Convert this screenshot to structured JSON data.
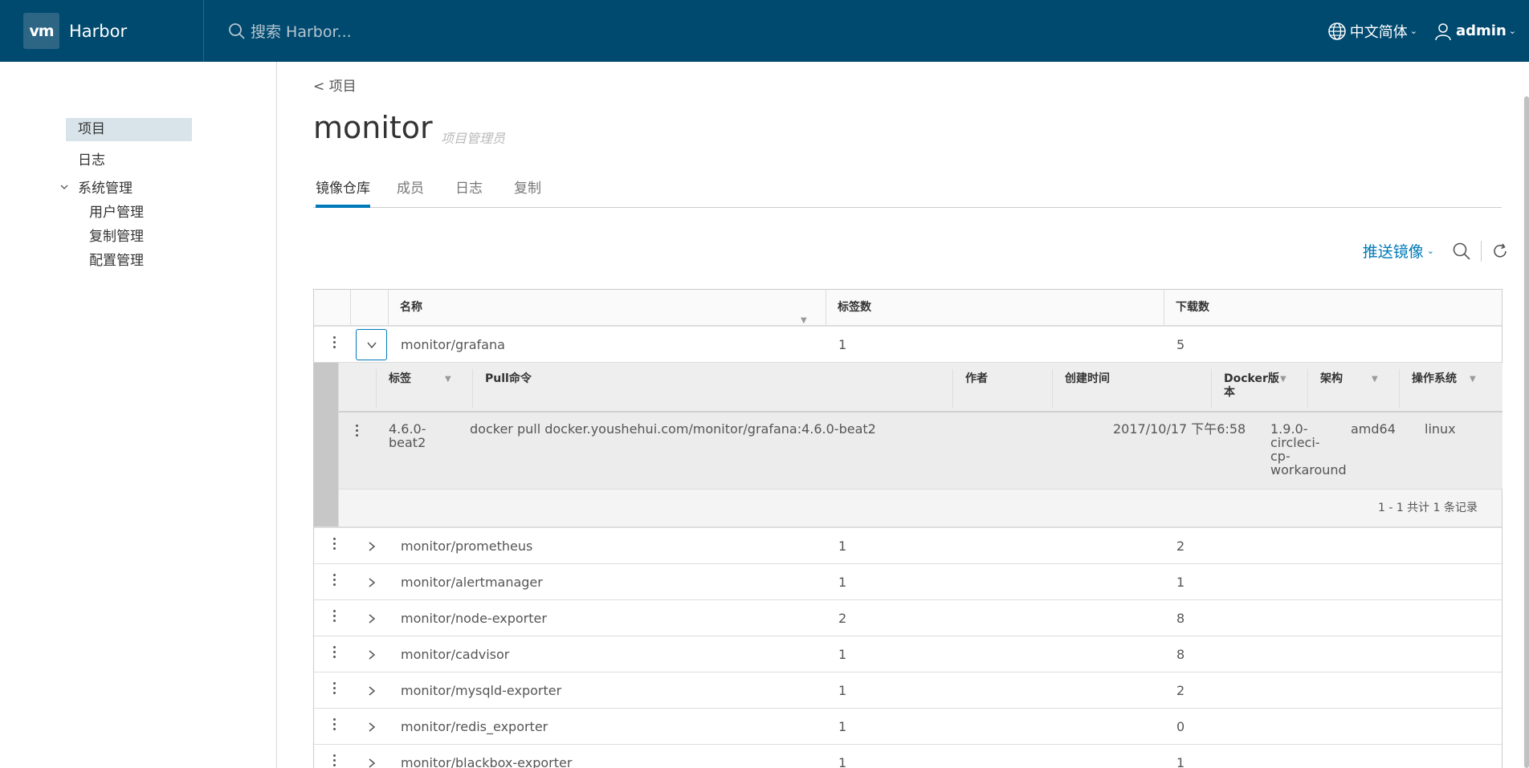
{
  "header": {
    "logo_text": "vm",
    "app_name": "Harbor",
    "search_placeholder": "搜索 Harbor...",
    "language": "中文简体",
    "user": "admin"
  },
  "sidebar": {
    "items": [
      {
        "label": "项目"
      },
      {
        "label": "日志"
      },
      {
        "label": "系统管理"
      }
    ],
    "sub_items": [
      {
        "label": "用户管理"
      },
      {
        "label": "复制管理"
      },
      {
        "label": "配置管理"
      }
    ]
  },
  "page": {
    "breadcrumb": "< 项目",
    "title": "monitor",
    "role": "项目管理员"
  },
  "tabs": [
    {
      "label": "镜像仓库"
    },
    {
      "label": "成员"
    },
    {
      "label": "日志"
    },
    {
      "label": "复制"
    }
  ],
  "toolbar": {
    "push_label": "推送镜像"
  },
  "table": {
    "columns": [
      "名称",
      "标签数",
      "下载数"
    ],
    "rows": [
      {
        "name": "monitor/grafana",
        "tags": "1",
        "pulls": "5"
      },
      {
        "name": "monitor/prometheus",
        "tags": "1",
        "pulls": "2"
      },
      {
        "name": "monitor/alertmanager",
        "tags": "1",
        "pulls": "1"
      },
      {
        "name": "monitor/node-exporter",
        "tags": "2",
        "pulls": "8"
      },
      {
        "name": "monitor/cadvisor",
        "tags": "1",
        "pulls": "8"
      },
      {
        "name": "monitor/mysqld-exporter",
        "tags": "1",
        "pulls": "2"
      },
      {
        "name": "monitor/redis_exporter",
        "tags": "1",
        "pulls": "0"
      },
      {
        "name": "monitor/blackbox-exporter",
        "tags": "1",
        "pulls": "1"
      }
    ]
  },
  "detail": {
    "columns": {
      "tag": "标签",
      "pull": "Pull命令",
      "author": "作者",
      "created": "创建时间",
      "docker1": "Docker版",
      "docker2": "本",
      "arch": "架构",
      "os": "操作系统"
    },
    "row": {
      "tag1": "4.6.0-",
      "tag2": "beat2",
      "pull": "docker pull docker.youshehui.com/monitor/grafana:4.6.0-beat2",
      "author": "",
      "created": "2017/10/17 下午6:58",
      "docker1": "1.9.0-",
      "docker2": "circleci-",
      "docker3": "cp-",
      "docker4": "workaround",
      "arch": "amd64",
      "os": "linux"
    },
    "footer": "1 - 1 共计 1 条记录"
  },
  "colors": {
    "header_bg": "#004a70",
    "accent": "#0079b8"
  }
}
